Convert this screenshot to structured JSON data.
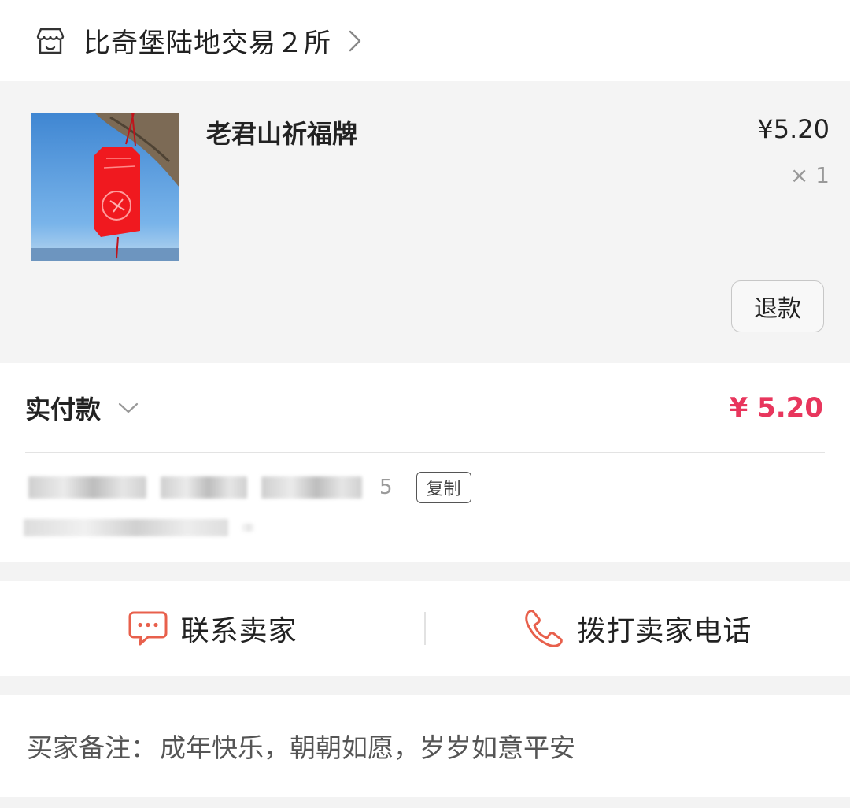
{
  "shop": {
    "name": "比奇堡陆地交易２所",
    "icon": "shop-icon",
    "chevron_icon": "chevron-right-icon"
  },
  "product": {
    "title": "老君山祈福牌",
    "price": "¥5.20",
    "quantity": "× 1",
    "thumbnail_alt": "red prayer tag hanging on a tree branch against a blue sky",
    "refund_label": "退款"
  },
  "payment": {
    "paid_label": "实付款",
    "paid_amount": "¥ 5.20",
    "accent_color": "#e8365d",
    "order_number_visible_tail": "5",
    "copy_label": "复制"
  },
  "contact": {
    "chat_label": "联系卖家",
    "chat_icon": "chat-bubble-icon",
    "call_label": "拨打卖家电话",
    "call_icon": "phone-icon",
    "icon_color": "#e8604c"
  },
  "note": {
    "label": "买家备注：",
    "text": "成年快乐，朝朝如愿，岁岁如意平安"
  }
}
